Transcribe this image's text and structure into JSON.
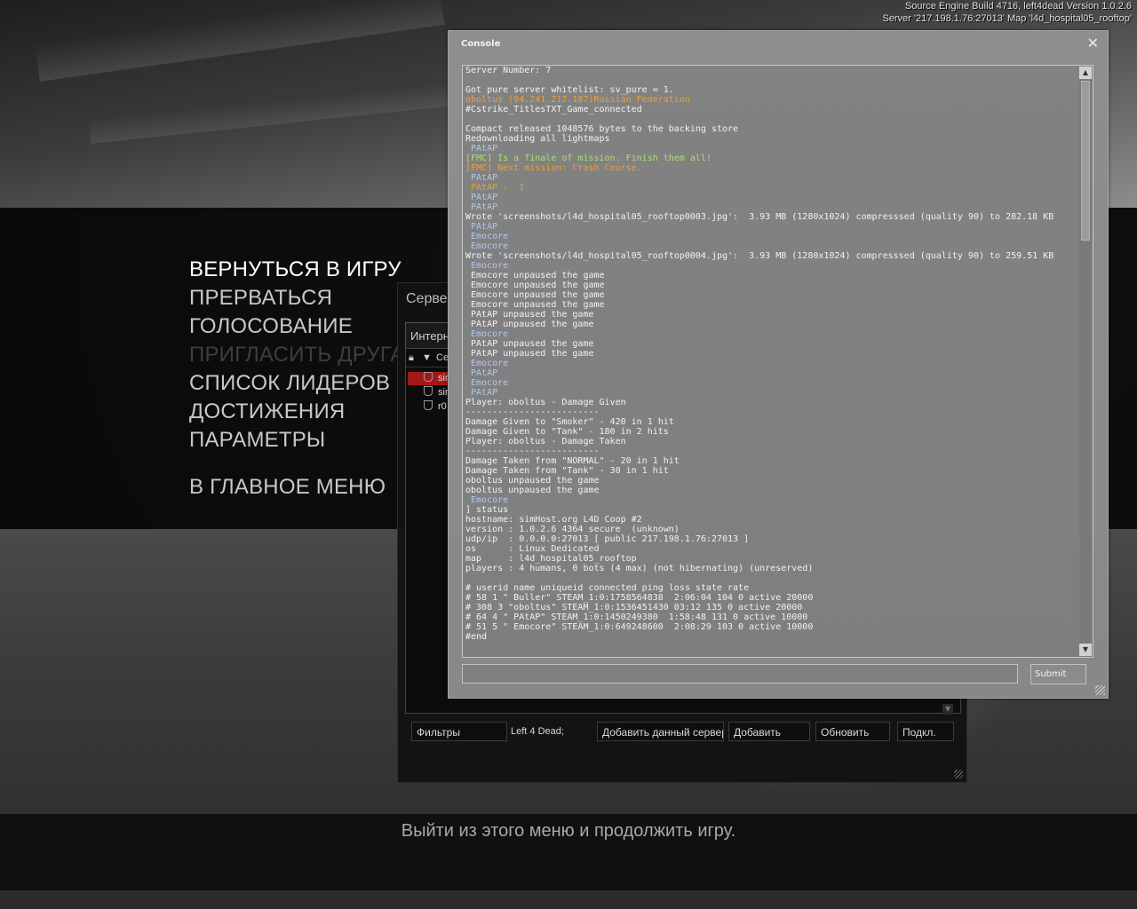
{
  "build_info": {
    "line1": "Source Engine Build 4716, left4dead Version 1.0.2.6",
    "line2": "Server '217.198.1.76:27013' Map 'l4d_hospital05_rooftop'"
  },
  "main_menu": {
    "items": [
      {
        "label": "ВЕРНУТЬСЯ В ИГРУ",
        "state": "active"
      },
      {
        "label": "ПРЕРВАТЬСЯ",
        "state": "normal"
      },
      {
        "label": "ГОЛОСОВАНИЕ",
        "state": "normal"
      },
      {
        "label": "ПРИГЛАСИТЬ ДРУГА",
        "state": "disabled"
      },
      {
        "label": "СПИСОК ЛИДЕРОВ",
        "state": "normal"
      },
      {
        "label": "ДОСТИЖЕНИЯ",
        "state": "normal"
      },
      {
        "label": "ПАРАМЕТРЫ",
        "state": "normal"
      },
      {
        "label": "В ГЛАВНОЕ МЕНЮ",
        "state": "normal"
      }
    ]
  },
  "hint": "Выйти из этого меню и продолжить игру.",
  "server_browser": {
    "title": "Сервер",
    "tab": "Интерн",
    "column_header": "Сер",
    "rows": [
      {
        "name": "sim",
        "selected": true
      },
      {
        "name": "sim",
        "selected": false
      },
      {
        "name": "r0",
        "selected": false
      }
    ],
    "footer": {
      "filters": "Фильтры",
      "game_filter": "Left 4 Dead;",
      "add_current": "Добавить данный сервер",
      "add": "Добавить",
      "refresh": "Обновить",
      "connect": "Подкл."
    }
  },
  "console": {
    "title": "Console",
    "submit_label": "Submit",
    "input_value": "",
    "colors": {
      "orange": "#f0a030",
      "blue": "#b0c8ec",
      "green": "#a8e070"
    },
    "lines": [
      {
        "t": "Server Number: 7",
        "c": ""
      },
      {
        "t": "",
        "c": ""
      },
      {
        "t": "Got pure server whitelist: sv_pure = 1.",
        "c": ""
      },
      {
        "t": "oboltus (94.241.217.187)Russian Federation",
        "c": "orange"
      },
      {
        "t": "#Cstrike_TitlesTXT_Game_connected",
        "c": ""
      },
      {
        "t": "",
        "c": ""
      },
      {
        "t": "Compact released 1048576 bytes to the backing store",
        "c": ""
      },
      {
        "t": "Redownloading all lightmaps",
        "c": ""
      },
      {
        "t": " PAtAP",
        "c": "blue"
      },
      {
        "t": "[FMC] Is a finale of mission. Finish them all!",
        "c": "green"
      },
      {
        "t": "[FMC] Next mission: Crash Course.",
        "c": "orange"
      },
      {
        "t": " PAtAP",
        "c": "blue"
      },
      {
        "t": " PAtAP :  1",
        "c": "orange"
      },
      {
        "t": " PAtAP",
        "c": "blue"
      },
      {
        "t": " PAtAP",
        "c": "blue"
      },
      {
        "t": "Wrote 'screenshots/l4d_hospital05_rooftop0003.jpg':  3.93 MB (1280x1024) compresssed (quality 90) to 282.18 KB",
        "c": ""
      },
      {
        "t": " PAtAP",
        "c": "blue"
      },
      {
        "t": " Emocore",
        "c": "blue"
      },
      {
        "t": " Emocore",
        "c": "blue"
      },
      {
        "t": "Wrote 'screenshots/l4d_hospital05_rooftop0004.jpg':  3.93 MB (1280x1024) compresssed (quality 90) to 259.51 KB",
        "c": ""
      },
      {
        "t": " Emocore",
        "c": "blue"
      },
      {
        "t": " Emocore unpaused the game",
        "c": ""
      },
      {
        "t": " Emocore unpaused the game",
        "c": ""
      },
      {
        "t": " Emocore unpaused the game",
        "c": ""
      },
      {
        "t": " Emocore unpaused the game",
        "c": ""
      },
      {
        "t": " PAtAP unpaused the game",
        "c": ""
      },
      {
        "t": " PAtAP unpaused the game",
        "c": ""
      },
      {
        "t": " Emocore",
        "c": "blue"
      },
      {
        "t": " PAtAP unpaused the game",
        "c": ""
      },
      {
        "t": " PAtAP unpaused the game",
        "c": ""
      },
      {
        "t": " Emocore",
        "c": "blue"
      },
      {
        "t": " PAtAP",
        "c": "blue"
      },
      {
        "t": " Emocore",
        "c": "blue"
      },
      {
        "t": " PAtAP",
        "c": "blue"
      },
      {
        "t": "Player: oboltus - Damage Given",
        "c": ""
      },
      {
        "t": "-------------------------",
        "c": ""
      },
      {
        "t": "Damage Given to \"Smoker\" - 420 in 1 hit",
        "c": ""
      },
      {
        "t": "Damage Given to \"Tank\" - 180 in 2 hits",
        "c": ""
      },
      {
        "t": "Player: oboltus - Damage Taken",
        "c": ""
      },
      {
        "t": "-------------------------",
        "c": ""
      },
      {
        "t": "Damage Taken from \"NORMAL\" - 20 in 1 hit",
        "c": ""
      },
      {
        "t": "Damage Taken from \"Tank\" - 30 in 1 hit",
        "c": ""
      },
      {
        "t": "oboltus unpaused the game",
        "c": ""
      },
      {
        "t": "oboltus unpaused the game",
        "c": ""
      },
      {
        "t": " Emocore",
        "c": "blue"
      },
      {
        "t": "] status",
        "c": ""
      },
      {
        "t": "hostname: simHost.org L4D Coop #2",
        "c": ""
      },
      {
        "t": "version : 1.0.2.6 4364 secure  (unknown)",
        "c": ""
      },
      {
        "t": "udp/ip  : 0.0.0.0:27013 [ public 217.198.1.76:27013 ]",
        "c": ""
      },
      {
        "t": "os      : Linux Dedicated",
        "c": ""
      },
      {
        "t": "map     : l4d_hospital05_rooftop",
        "c": ""
      },
      {
        "t": "players : 4 humans, 0 bots (4 max) (not hibernating) (unreserved)",
        "c": ""
      },
      {
        "t": "",
        "c": ""
      },
      {
        "t": "# userid name uniqueid connected ping loss state rate",
        "c": ""
      },
      {
        "t": "# 58 1 \" Buller\" STEAM_1:0:1758564838  2:06:04 104 0 active 20000",
        "c": ""
      },
      {
        "t": "# 308 3 \"oboltus\" STEAM_1:0:1536451430 03:12 135 0 active 20000",
        "c": ""
      },
      {
        "t": "# 64 4 \" PAtAP\" STEAM_1:0:1450249380  1:58:48 131 0 active 10000",
        "c": ""
      },
      {
        "t": "# 51 5 \" Emocore\" STEAM_1:0:649248600  2:08:29 103 0 active 10000",
        "c": ""
      },
      {
        "t": "#end",
        "c": ""
      }
    ]
  }
}
